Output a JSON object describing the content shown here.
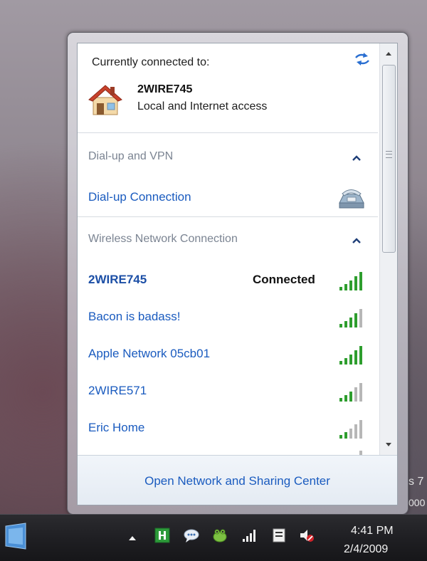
{
  "popup": {
    "current": {
      "label": "Currently connected to:",
      "network_name": "2WIRE745",
      "access": "Local and Internet access",
      "icon": "house-icon",
      "refresh_icon": "refresh-icon"
    },
    "sections": [
      {
        "title": "Dial-up and VPN",
        "items": [
          {
            "name": "Dial-up Connection",
            "icon": "dialup-phone-icon"
          }
        ]
      },
      {
        "title": "Wireless Network Connection",
        "networks": [
          {
            "name": "2WIRE745",
            "status": "Connected",
            "signal_bars": 5
          },
          {
            "name": "Bacon is badass!",
            "status": "",
            "signal_bars": 4
          },
          {
            "name": "Apple Network 05cb01",
            "status": "",
            "signal_bars": 5
          },
          {
            "name": "2WIRE571",
            "status": "",
            "signal_bars": 3
          },
          {
            "name": "Eric Home",
            "status": "",
            "signal_bars": 2
          }
        ]
      }
    ],
    "footer_link": "Open Network and Sharing Center"
  },
  "desktop": {
    "peek_1": "s 7",
    "peek_2": "000"
  },
  "taskbar": {
    "clock": {
      "time": "4:41 PM",
      "date": "2/4/2009"
    },
    "tray_icons": [
      "show-hidden-arrow",
      "app-tray-icon",
      "chat-bubble-icon",
      "frog-tray-icon",
      "network-signal-icon",
      "action-center-icon",
      "volume-muted-icon"
    ]
  },
  "colors": {
    "link": "#1a5bbf",
    "section": "#7b8492",
    "signal": "#2e9e2e",
    "signal_off": "#b7b7b7"
  }
}
